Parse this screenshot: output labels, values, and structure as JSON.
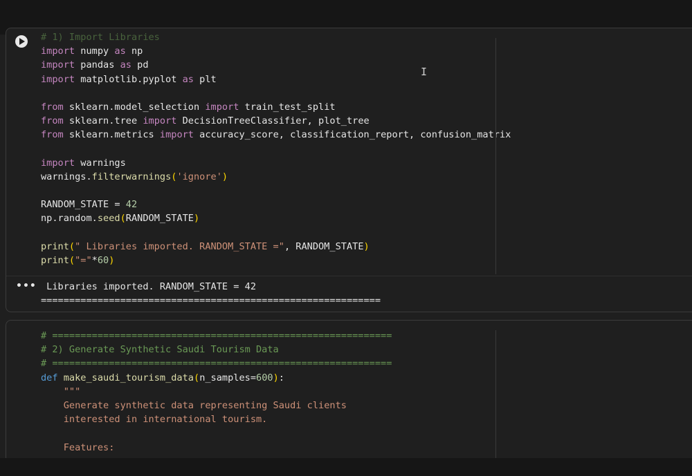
{
  "cell1": {
    "header_comment": "# 1) Import Libraries",
    "lines": [
      [
        "import numpy as np"
      ],
      [
        "import pandas as pd"
      ],
      [
        "import matplotlib.pyplot as plt"
      ],
      [
        ""
      ],
      [
        "from sklearn.model_selection import train_test_split"
      ],
      [
        "from sklearn.tree import DecisionTreeClassifier, plot_tree"
      ],
      [
        "from sklearn.metrics import accuracy_score, classification_report, confusion_matrix"
      ],
      [
        ""
      ],
      [
        "import warnings"
      ],
      [
        "warnings.filterwarnings('ignore')"
      ],
      [
        ""
      ],
      [
        "RANDOM_STATE = 42"
      ],
      [
        "np.random.seed(RANDOM_STATE)"
      ],
      [
        ""
      ],
      [
        "print(\" Libraries imported. RANDOM_STATE =\", RANDOM_STATE)"
      ],
      [
        "print(\"=\"*60)"
      ]
    ],
    "output_line1": " Libraries imported. RANDOM_STATE = 42",
    "output_line2": "============================================================",
    "output_menu": "•••"
  },
  "cell2": {
    "lines": [
      "# ============================================================",
      "# 2) Generate Synthetic Saudi Tourism Data",
      "# ============================================================",
      "def make_saudi_tourism_data(n_samples=600):",
      "    \"\"\"",
      "    Generate synthetic data representing Saudi clients",
      "    interested in international tourism.",
      "",
      "    Features:"
    ]
  },
  "colors": {
    "keyword": "#c586c0",
    "def_keyword": "#569cd6",
    "function": "#dcdcaa",
    "string": "#ce9178",
    "number": "#b5cea8",
    "comment": "#6a9955"
  },
  "icons": {
    "run": "play-circle-icon",
    "output_menu": "more-horizontal-icon",
    "cursor": "text-cursor-icon"
  }
}
